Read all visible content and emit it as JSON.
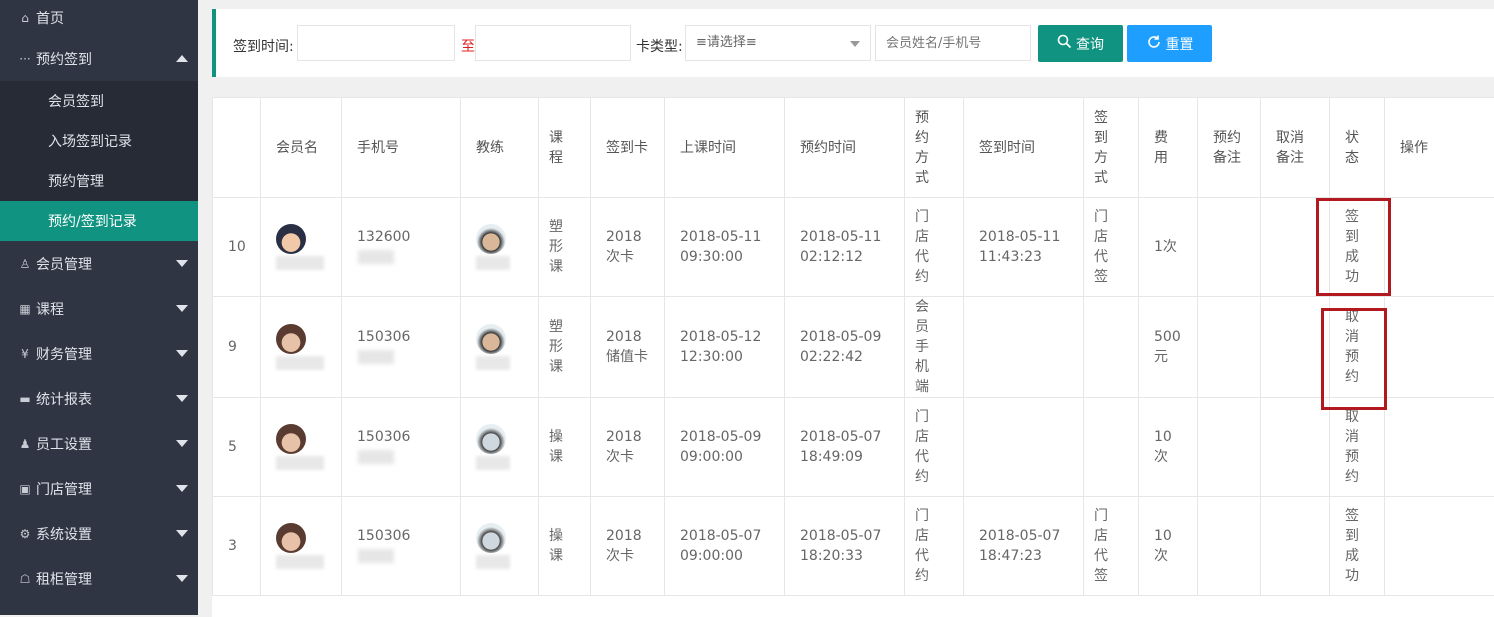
{
  "sidebar": {
    "home": "首页",
    "group_label": "预约签到",
    "sub_items": [
      "会员签到",
      "入场签到记录",
      "预约管理",
      "预约/签到记录"
    ],
    "menu": [
      "会员管理",
      "课程",
      "财务管理",
      "统计报表",
      "员工设置",
      "门店管理",
      "系统设置",
      "租柜管理"
    ]
  },
  "filter": {
    "signin_label": "签到时间:",
    "to": "至",
    "card_type_label": "卡类型:",
    "card_type_value": "≡请选择≡",
    "member_placeholder": "会员姓名/手机号",
    "query": "查询",
    "reset": "重置"
  },
  "table": {
    "headers": [
      "",
      "会员名",
      "手机号",
      "教练",
      "课程",
      "签到卡",
      "上课时间",
      "预约时间",
      "预约方式",
      "签到时间",
      "签到方式",
      "费用",
      "预约备注",
      "取消备注",
      "状态",
      "操作"
    ],
    "rows": [
      {
        "id": "10",
        "phone": "132600",
        "course": "塑形课",
        "card": "2018次卡",
        "class_time": "2018-05-11 09:30:00",
        "book_time": "2018-05-11 02:12:12",
        "book_method": "门店代约",
        "sign_time": "2018-05-11 11:43:23",
        "sign_method": "门店代签",
        "fee": "1次",
        "status": "签到成功"
      },
      {
        "id": "9",
        "phone": "150306",
        "course": "塑形课",
        "card": "2018储值卡",
        "class_time": "2018-05-12 12:30:00",
        "book_time": "2018-05-09 02:22:42",
        "book_method": "会员手机端",
        "sign_time": "",
        "sign_method": "",
        "fee": "500元",
        "status": "取消预约"
      },
      {
        "id": "5",
        "phone": "150306",
        "course": "操课",
        "card": "2018次卡",
        "class_time": "2018-05-09 09:00:00",
        "book_time": "2018-05-07 18:49:09",
        "book_method": "门店代约",
        "sign_time": "",
        "sign_method": "",
        "fee": "10次",
        "status": "取消预约"
      },
      {
        "id": "3",
        "phone": "150306",
        "course": "操课",
        "card": "2018次卡",
        "class_time": "2018-05-07 09:00:00",
        "book_time": "2018-05-07 18:20:33",
        "book_method": "门店代约",
        "sign_time": "2018-05-07 18:47:23",
        "sign_method": "门店代签",
        "fee": "10次",
        "status": "签到成功"
      }
    ]
  },
  "colors": {
    "sidebar_bg": "#2f3543",
    "accent": "#109481",
    "reset": "#1e9fff",
    "highlight": "#b2191e"
  }
}
